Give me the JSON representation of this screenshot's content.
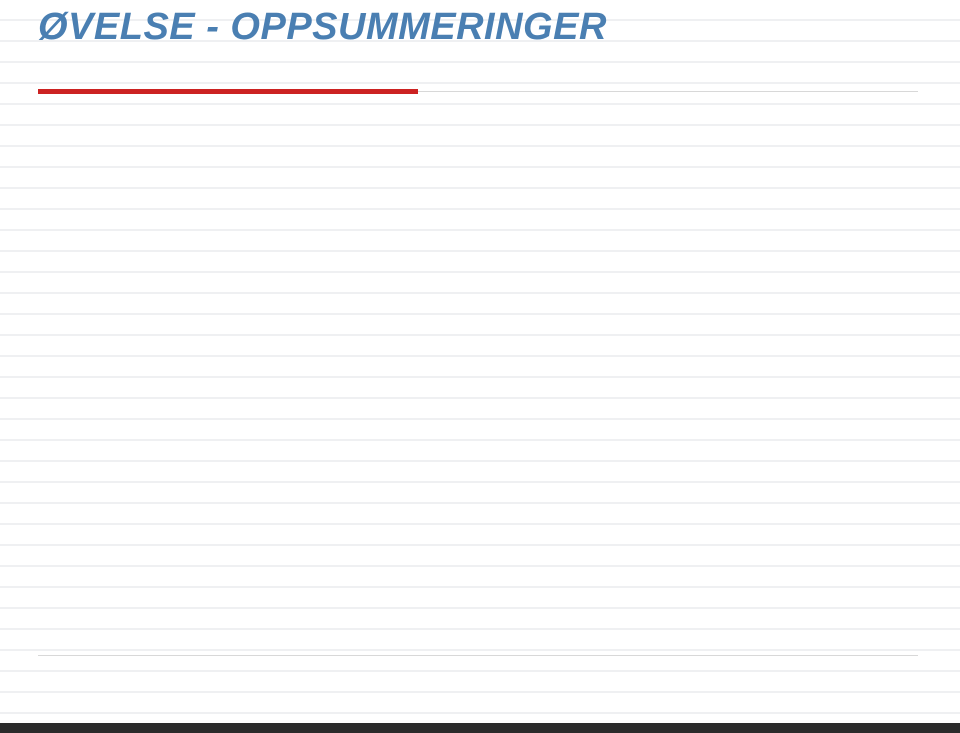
{
  "slide": {
    "title": "ØVELSE - OPPSUMMERINGER"
  },
  "colors": {
    "title": "#4a7fb2",
    "accent": "#cc2222",
    "line": "#eff0f2",
    "footer": "#2b2b2b"
  }
}
